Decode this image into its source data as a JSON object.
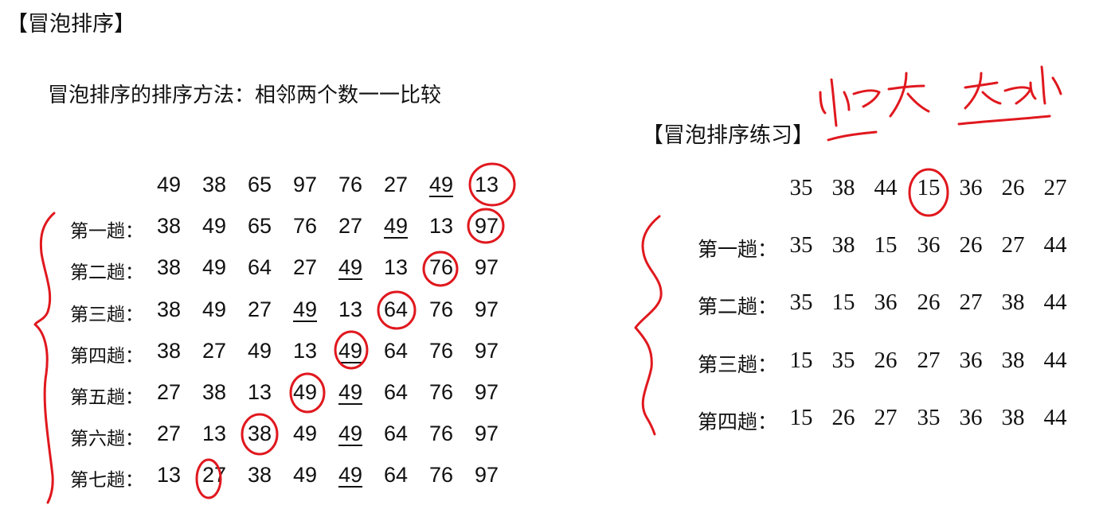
{
  "main_title": "【冒泡排序】",
  "description": "冒泡排序的排序方法：相邻两个数一一比较",
  "left_table": {
    "initial": [
      "49",
      "38",
      "65",
      "97",
      "76",
      "27",
      "49",
      "13"
    ],
    "rows": [
      {
        "label": "第一趟：",
        "values": [
          "38",
          "49",
          "65",
          "76",
          "27",
          "49",
          "13",
          "97"
        ]
      },
      {
        "label": "第二趟：",
        "values": [
          "38",
          "49",
          "64",
          "27",
          "49",
          "13",
          "76",
          "97"
        ]
      },
      {
        "label": "第三趟：",
        "values": [
          "38",
          "49",
          "27",
          "49",
          "13",
          "64",
          "76",
          "97"
        ]
      },
      {
        "label": "第四趟：",
        "values": [
          "38",
          "27",
          "49",
          "13",
          "49",
          "64",
          "76",
          "97"
        ]
      },
      {
        "label": "第五趟：",
        "values": [
          "27",
          "38",
          "13",
          "49",
          "49",
          "64",
          "76",
          "97"
        ]
      },
      {
        "label": "第六趟：",
        "values": [
          "27",
          "13",
          "38",
          "49",
          "49",
          "64",
          "76",
          "97"
        ]
      },
      {
        "label": "第七趟：",
        "values": [
          "13",
          "27",
          "38",
          "49",
          "49",
          "64",
          "76",
          "97"
        ]
      }
    ]
  },
  "practice_title": "【冒泡排序练习】",
  "right_table": {
    "initial": [
      "35",
      "38",
      "44",
      "15",
      "36",
      "26",
      "27"
    ],
    "rows": [
      {
        "label": "第一趟：",
        "values": [
          "35",
          "38",
          "15",
          "36",
          "26",
          "27",
          "44"
        ]
      },
      {
        "label": "第二趟：",
        "values": [
          "35",
          "15",
          "36",
          "26",
          "27",
          "38",
          "44"
        ]
      },
      {
        "label": "第三趟：",
        "values": [
          "15",
          "35",
          "26",
          "27",
          "36",
          "38",
          "44"
        ]
      },
      {
        "label": "第四趟：",
        "values": [
          "15",
          "26",
          "27",
          "35",
          "36",
          "38",
          "44"
        ]
      }
    ]
  },
  "annotations": {
    "ink_color": "#e0181e"
  }
}
